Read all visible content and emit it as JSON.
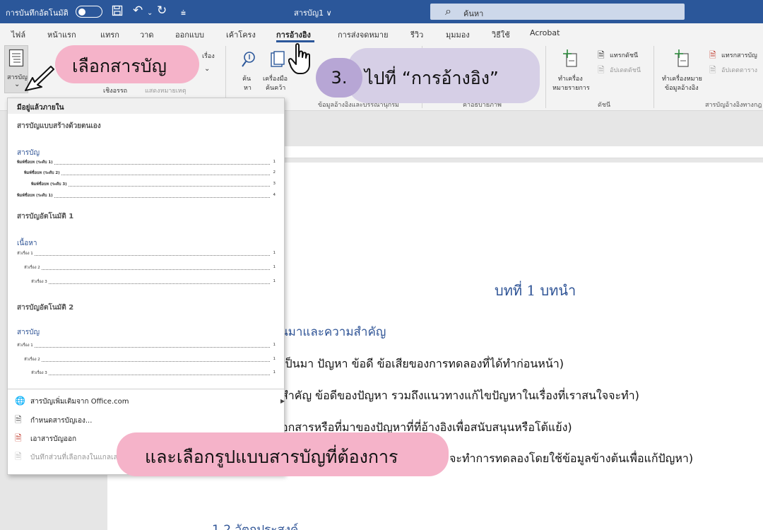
{
  "titlebar": {
    "autosave_label": "การบันทึกอัตโนมัติ",
    "doc_title": "สารบัญ1 ∨",
    "search_placeholder": "ค้นหา"
  },
  "tabs": [
    {
      "label": "ไฟล์"
    },
    {
      "label": "หน้าแรก"
    },
    {
      "label": "แทรก"
    },
    {
      "label": "วาด"
    },
    {
      "label": "ออกแบบ"
    },
    {
      "label": "เค้าโครง"
    },
    {
      "label": "การอ้างอิง",
      "active": true
    },
    {
      "label": "การส่งจดหมาย"
    },
    {
      "label": "รีวิว"
    },
    {
      "label": "มุมมอง"
    },
    {
      "label": "วิธีใช้"
    },
    {
      "label": "Acrobat"
    }
  ],
  "ribbon": {
    "toc_label": "สารบัญ",
    "chevron": "⌄",
    "text_add": "เรื่อง",
    "footnote_caption": "เชิงอรรถ",
    "show_notes": "แสดงหมายเหตุ",
    "search_label_top": "ค้น",
    "search_label_bottom": "หา",
    "researcher_top": "เครื่องมือ",
    "researcher_bottom": "ค้นคว้า",
    "citations_group": "ข้อมูลอ้างอิงและบรรณานุกรม",
    "captions_group": "คำอธิบายภาพ",
    "mark_entry_top": "ทำเครื่อง",
    "mark_entry_bottom": "หมายรายการ",
    "insert_index": "แทรกดัชนี",
    "update_index": "อัปเดตดัชนี",
    "index_group": "ดัชนี",
    "mark_citation_top": "ทำเครื่องหมาย",
    "mark_citation_bottom": "ข้อมูลอ้างอิง",
    "insert_toa": "แทรกสารบัญ",
    "update_toa": "อัปเดตตาราง",
    "toa_group": "สารบัญอ้างอิงทางกฎ"
  },
  "dropdown": {
    "header": "มีอยู่แล้วภายใน",
    "manual_section": "สารบัญแบบสร้างด้วยตนเอง",
    "manual_title": "สารบัญ",
    "manual_entries": [
      {
        "label": "พิมพ์ชื่อบท (ระดับ 1)",
        "page": "1"
      },
      {
        "label": "พิมพ์ชื่อบท (ระดับ 2)",
        "page": "2"
      },
      {
        "label": "พิมพ์ชื่อบท (ระดับ 3)",
        "page": "3"
      },
      {
        "label": "พิมพ์ชื่อบท (ระดับ 1)",
        "page": "4"
      }
    ],
    "auto1_section": "สารบัญอัตโนมัติ 1",
    "auto1_title": "เนื้อหา",
    "auto1_entries": [
      {
        "label": "หัวเรื่อง 1",
        "page": "1"
      },
      {
        "label": "หัวเรื่อง 2",
        "page": "1"
      },
      {
        "label": "หัวเรื่อง 3",
        "page": "1"
      }
    ],
    "auto2_section": "สารบัญอัตโนมัติ 2",
    "auto2_title": "สารบัญ",
    "auto2_entries": [
      {
        "label": "หัวเรื่อง 1",
        "page": "1"
      },
      {
        "label": "หัวเรื่อง 2",
        "page": "1"
      },
      {
        "label": "หัวเรื่อง 3",
        "page": "1"
      }
    ],
    "more_toc": "สารบัญเพิ่มเติมจาก Office.com",
    "custom_toc": "กำหนดสารบัญเอง...",
    "remove_toc": "เอาสารบัญออก",
    "save_selection": "บันทึกส่วนที่เลือกลงในแกลเลอรี"
  },
  "document": {
    "chapter_heading": "บทที่ 1 บทนำ",
    "subheading": "นมาและความสำคัญ",
    "line1": "เป็นมา ปัญหา ข้อดี ข้อเสียของการทดลองที่ได้ทำก่อนหน้า)",
    "line2": "สำคัญ ข้อดีของปัญหา รวมถึงแนวทางแก้ไขปัญหาในเรื่องที่เราสนใจจะทำ)",
    "line3": "อกสารหรือที่มาของปัญหาที่ที่อ้างอิงเพื่อสนับสนุนหรือโต้แย้ง)",
    "line4": "จะทำการทดลองโดยใช้ข้อมูลข้างต้นเพื่อแก้ปัญหา)",
    "next_heading": "1.2 วัตถุประสงค์"
  },
  "callouts": {
    "select_toc": "เลือกสารบัญ",
    "step_number": "3.",
    "goto_references": "ไปที่ “การอ้างอิง”",
    "choose_format": "และเลือกรูปแบบสารบัญที่ต้องการ"
  },
  "colors": {
    "title_bar": "#2b579a",
    "heading_blue": "#2f5496",
    "callout_pink": "#f5b3c9",
    "callout_purple": "#d6cfe6",
    "step_circle": "#b7a6d5"
  }
}
